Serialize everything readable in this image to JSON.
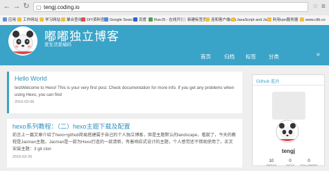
{
  "browser": {
    "url": "tengj.coding.io",
    "bookmarks": [
      "应用",
      "工作网站",
      "学习网站",
      "聚合查询",
      "DIY资料查询",
      "Google Search",
      "百度",
      "RunJS - 在线开发",
      "新建标签页",
      "连和客户端vpn",
      "JavaScript and Java",
      "利用vpn服务器",
      "www.cilb.co"
    ]
  },
  "header": {
    "title": "嘟嘟独立博客",
    "subtitle": "爱生活爱编码",
    "nav": [
      "首页",
      "归档",
      "标签",
      "分类"
    ]
  },
  "posts": [
    {
      "title": "Hello World",
      "body": "testWelcome to Hexo! This is your very first post. Check documentation for more info. If you get any problems when using Hexo, you can find",
      "date": "2016-03-06"
    },
    {
      "title": "hexo系列教程：（二）hexo主题下载及配置",
      "body": "前言上一篇文章介绍了hexo+github简易搭建属于自己的个人独立博客，但是主题默认的landscape，看腻了，今天的教程是Jacman主题。Jacman是一款为Hexo打造的一款清新，有着响应式设计的主题，个人感觉还不错就使用了。正文安装主题：3 git clon",
      "date": "2016-02-26"
    }
  ],
  "sidebar": {
    "title": "Github 名片",
    "username": "tengj",
    "stats": [
      {
        "value": "10",
        "label": "REPOS"
      },
      {
        "value": "0",
        "label": "GISTS"
      },
      {
        "value": "0",
        "label": "FOLLOWERS"
      }
    ]
  }
}
